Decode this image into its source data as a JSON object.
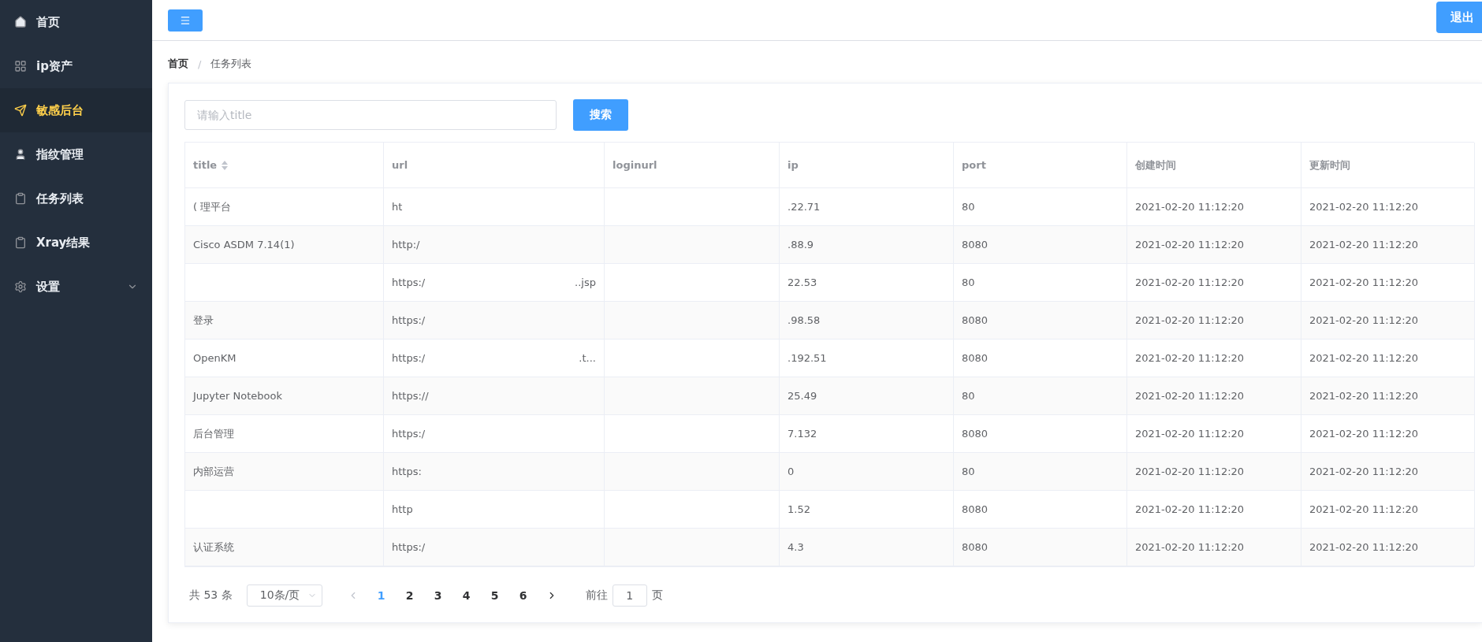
{
  "sidebar": {
    "items": [
      {
        "label": "首页",
        "kind": "item",
        "selected": false
      },
      {
        "label": "ip资产",
        "kind": "item",
        "selected": false
      },
      {
        "label": "敏感后台",
        "kind": "item",
        "selected": true
      },
      {
        "label": "指纹管理",
        "kind": "item",
        "selected": false
      },
      {
        "label": "任务列表",
        "kind": "item",
        "selected": false
      },
      {
        "label": "Xray结果",
        "kind": "item",
        "selected": false
      },
      {
        "label": "设置",
        "kind": "submenu",
        "selected": false,
        "expanded": false
      }
    ]
  },
  "header": {
    "logout": "退出"
  },
  "breadcrumb": [
    {
      "label": "首页",
      "current": false
    },
    {
      "label": "任务列表",
      "current": true
    }
  ],
  "breadcrumb_separator": "/",
  "search": {
    "placeholder": "请输入title",
    "button": "搜索"
  },
  "table": {
    "columns": [
      {
        "label": "title",
        "sortable": true
      },
      {
        "label": "url",
        "sortable": false
      },
      {
        "label": "loginurl",
        "sortable": false
      },
      {
        "label": "ip",
        "sortable": false
      },
      {
        "label": "port",
        "sortable": false
      },
      {
        "label": "创建时间",
        "sortable": false
      },
      {
        "label": "更新时间",
        "sortable": false
      }
    ],
    "rows": [
      {
        "title": "( 理平台",
        "url": "ht",
        "ip": ".22.71",
        "port": "80",
        "created": "2021-02-20 11:12:20",
        "updated": "2021-02-20 11:12:20"
      },
      {
        "title": "Cisco ASDM 7.14(1)",
        "url": "http:/",
        "ip": ".88.9",
        "port": "8080",
        "created": "2021-02-20 11:12:20",
        "updated": "2021-02-20 11:12:20"
      },
      {
        "url": "https:/",
        "url_end": "..jsp",
        "ip": "22.53",
        "port": "80",
        "created": "2021-02-20 11:12:20",
        "updated": "2021-02-20 11:12:20"
      },
      {
        "title": "登录",
        "url": "https:/",
        "ip": ".98.58",
        "port": "8080",
        "created": "2021-02-20 11:12:20",
        "updated": "2021-02-20 11:12:20"
      },
      {
        "title": "OpenKM",
        "url": "https:/",
        "url_end": ".t...",
        "ip": ".192.51",
        "port": "8080",
        "created": "2021-02-20 11:12:20",
        "updated": "2021-02-20 11:12:20"
      },
      {
        "title": "Jupyter Notebook",
        "url": "https://",
        "ip": "25.49",
        "port": "80",
        "created": "2021-02-20 11:12:20",
        "updated": "2021-02-20 11:12:20"
      },
      {
        "title": "后台管理",
        "url": "https:/",
        "ip": "7.132",
        "port": "8080",
        "created": "2021-02-20 11:12:20",
        "updated": "2021-02-20 11:12:20"
      },
      {
        "title": "内部运营",
        "url": "https:",
        "ip": "0",
        "port": "80",
        "created": "2021-02-20 11:12:20",
        "updated": "2021-02-20 11:12:20"
      },
      {
        "url": "http",
        "ip": "1.52",
        "port": "8080",
        "created": "2021-02-20 11:12:20",
        "updated": "2021-02-20 11:12:20"
      },
      {
        "title": "认证系统",
        "url": "https:/",
        "ip": "4.3",
        "port": "8080",
        "created": "2021-02-20 11:12:20",
        "updated": "2021-02-20 11:12:20"
      }
    ]
  },
  "pagination": {
    "total": "共 53 条",
    "page_size": "10条/页",
    "pages": [
      {
        "label": "1",
        "selected": true
      },
      {
        "label": "2",
        "selected": false
      },
      {
        "label": "3",
        "selected": false
      },
      {
        "label": "4",
        "selected": false
      },
      {
        "label": "5",
        "selected": false
      },
      {
        "label": "6",
        "selected": false
      }
    ],
    "prev_disabled": true,
    "goto_label": "前往",
    "goto_value": "1",
    "goto_suffix": "页"
  }
}
